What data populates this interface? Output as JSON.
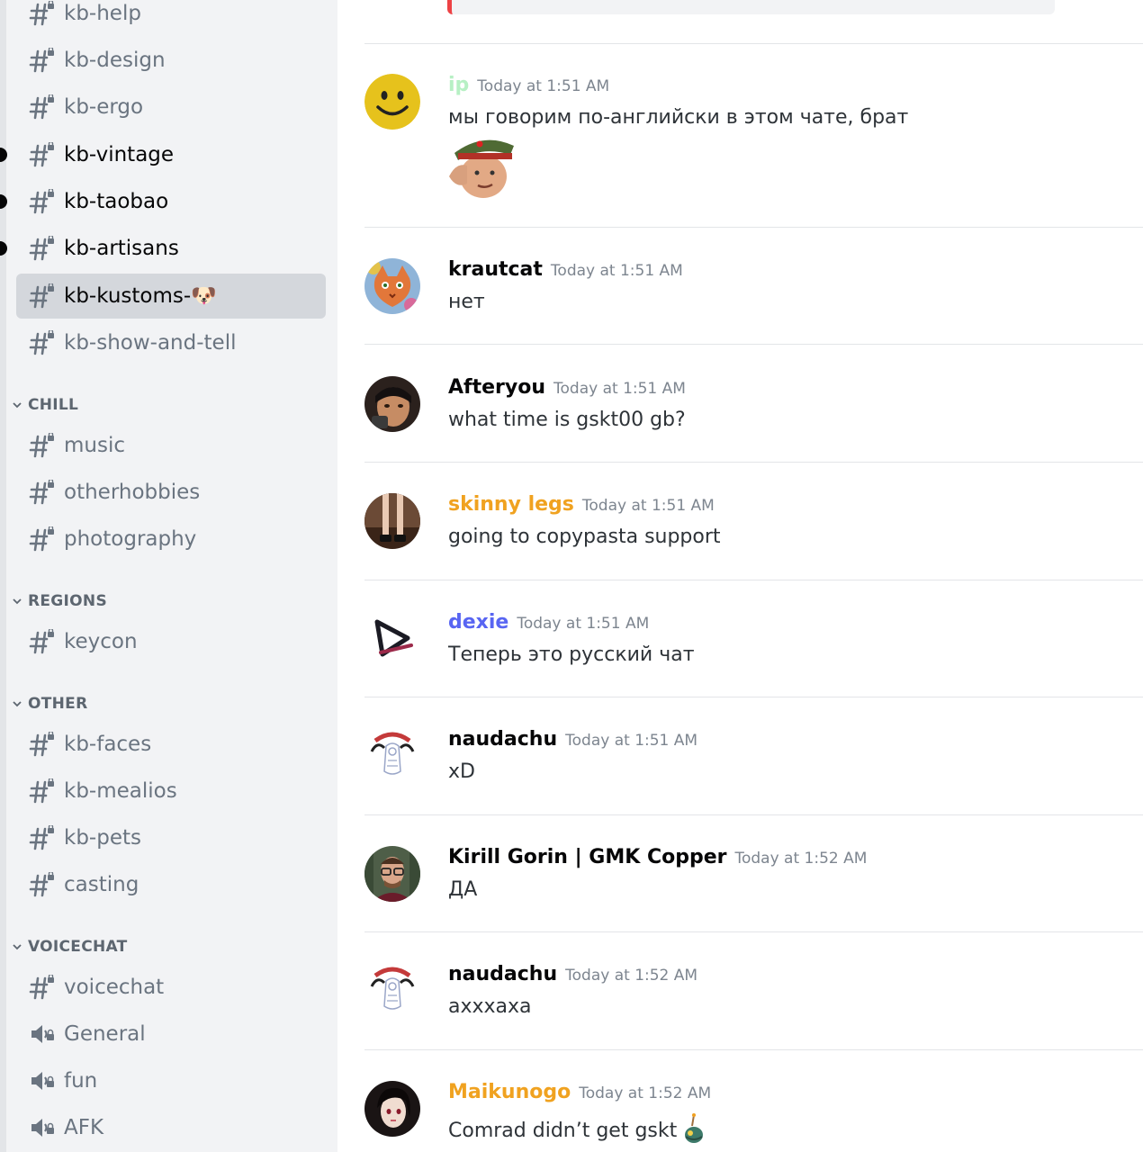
{
  "sidebar": {
    "channels_top": [
      {
        "label": "kb-help",
        "state": "normal"
      },
      {
        "label": "kb-design",
        "state": "normal"
      },
      {
        "label": "kb-ergo",
        "state": "normal"
      },
      {
        "label": "kb-vintage",
        "state": "unread"
      },
      {
        "label": "kb-taobao",
        "state": "unread"
      },
      {
        "label": "kb-artisans",
        "state": "unread"
      },
      {
        "label": "kb-kustoms-🐶",
        "state": "selected"
      },
      {
        "label": "kb-show-and-tell",
        "state": "normal"
      }
    ],
    "categories": [
      {
        "name": "CHILL",
        "channels": [
          "music",
          "otherhobbies",
          "photography"
        ]
      },
      {
        "name": "REGIONS",
        "channels": [
          "keycon"
        ]
      },
      {
        "name": "OTHER",
        "channels": [
          "kb-faces",
          "kb-mealios",
          "kb-pets",
          "casting"
        ]
      },
      {
        "name": "VOICECHAT",
        "channels": [
          "voicechat"
        ],
        "voice_channels": [
          "General",
          "fun",
          "AFK"
        ]
      }
    ]
  },
  "messages": [
    {
      "user": "ip",
      "color": "#b7f0c4",
      "time": "Today at 1:51 AM",
      "text": "мы говорим по-английски в этом чате, брат",
      "avatar": "smiley-avatar",
      "attachment": "saluting-soldier-emoji"
    },
    {
      "user": "krautcat",
      "color": "#060607",
      "time": "Today at 1:51 AM",
      "text": "нет",
      "avatar": "cat-painting-avatar"
    },
    {
      "user": "Afteryou",
      "color": "#060607",
      "time": "Today at 1:51 AM",
      "text": "what time is gskt00 gb?",
      "avatar": "person-photo-avatar"
    },
    {
      "user": "skinny legs",
      "color": "#f0a220",
      "time": "Today at 1:51 AM",
      "text": "going to copypasta support",
      "avatar": "legs-photo-avatar"
    },
    {
      "user": "dexie",
      "color": "#5865f2",
      "time": "Today at 1:51 AM",
      "text": "Теперь это русский чат",
      "avatar": "triangle-logo-avatar"
    },
    {
      "user": "naudachu",
      "color": "#060607",
      "time": "Today at 1:51 AM",
      "text": "xD",
      "avatar": "sketch-avatar"
    },
    {
      "user": "Kirill Gorin | GMK Copper",
      "color": "#060607",
      "time": "Today at 1:52 AM",
      "text": "ДА",
      "avatar": "glasses-man-avatar"
    },
    {
      "user": "naudachu",
      "color": "#060607",
      "time": "Today at 1:52 AM",
      "text": "ахххаха",
      "avatar": "sketch-avatar"
    },
    {
      "user": "Maikunogo",
      "color": "#f0a220",
      "time": "Today at 1:52 AM",
      "text": "Comrad didn’t get gskt",
      "avatar": "anime-girl-avatar",
      "inline_emoji": "bomb-emoji"
    }
  ]
}
